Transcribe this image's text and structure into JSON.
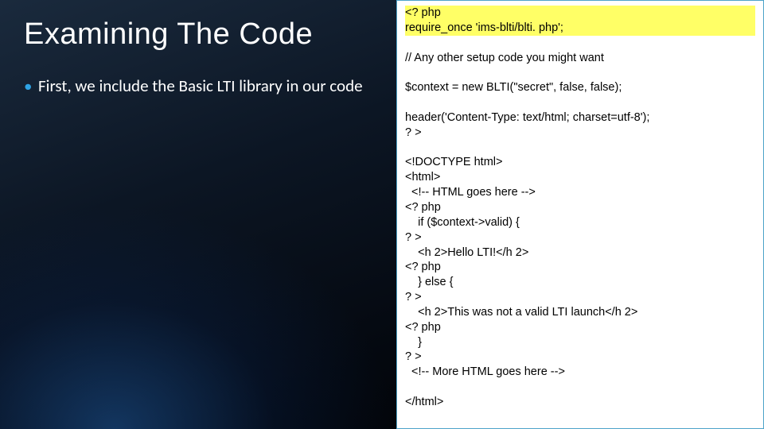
{
  "title": "Examining The Code",
  "bullets": [
    "First, we include the Basic LTI library in our code"
  ],
  "code": {
    "hl1": "<? php",
    "hl2": "require_once 'ims-blti/blti. php';",
    "rest": "\n// Any other setup code you might want\n\n$context = new BLTI(\"secret\", false, false);\n\nheader('Content-Type: text/html; charset=utf-8');\n? >\n\n<!DOCTYPE html>\n<html>\n  <!-- HTML goes here -->\n<? php\n    if ($context->valid) {\n? >\n    <h 2>Hello LTI!</h 2>\n<? php\n    } else {\n? >\n    <h 2>This was not a valid LTI launch</h 2>\n<? php\n    }\n? >\n  <!-- More HTML goes here -->\n\n</html>"
  }
}
